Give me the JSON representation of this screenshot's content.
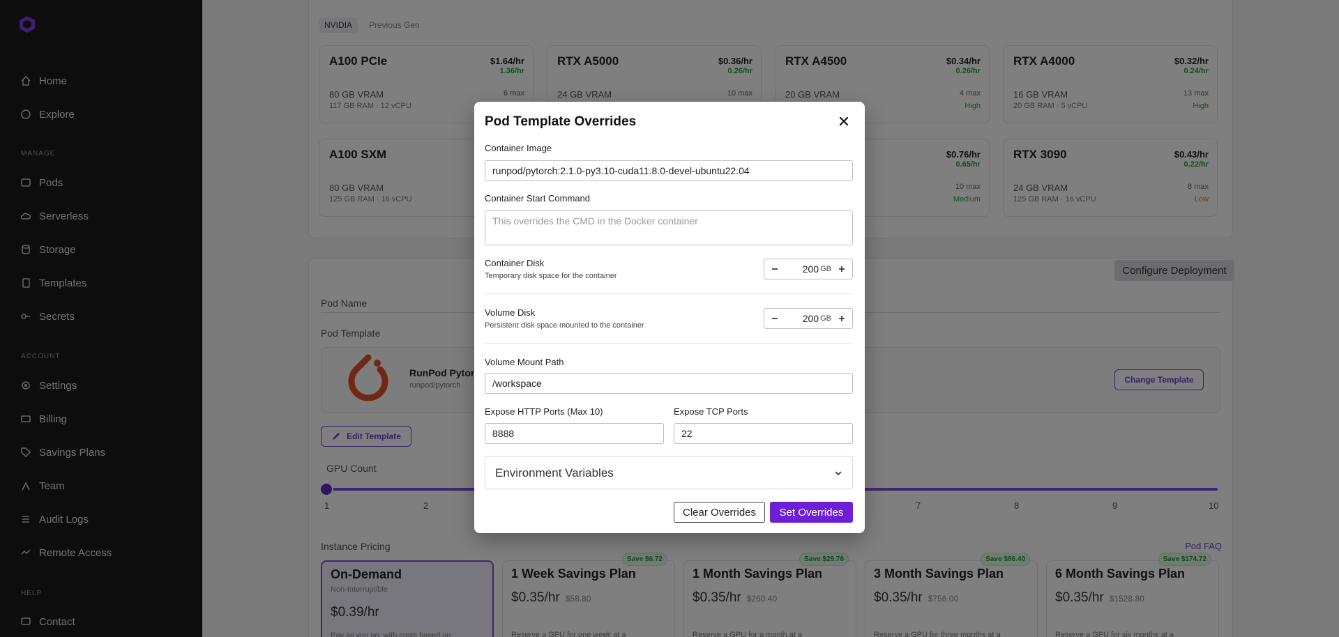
{
  "sidebar": {
    "items": [
      {
        "label": "Home",
        "icon": "home-icon"
      },
      {
        "label": "Explore",
        "icon": "compass-icon"
      },
      {
        "label": "Pods",
        "icon": "pods-icon"
      },
      {
        "label": "Serverless",
        "icon": "cloud-icon"
      },
      {
        "label": "Storage",
        "icon": "database-icon"
      },
      {
        "label": "Templates",
        "icon": "document-icon"
      },
      {
        "label": "Secrets",
        "icon": "key-icon"
      },
      {
        "label": "Settings",
        "icon": "gear-icon"
      },
      {
        "label": "Billing",
        "icon": "billing-icon"
      },
      {
        "label": "Savings Plans",
        "icon": "tag-icon"
      },
      {
        "label": "Team",
        "icon": "team-icon"
      },
      {
        "label": "Audit Logs",
        "icon": "list-icon"
      },
      {
        "label": "Remote Access",
        "icon": "remote-icon"
      },
      {
        "label": "Contact",
        "icon": "chat-icon"
      }
    ],
    "sections": {
      "manage": "MANAGE",
      "account": "ACCOUNT",
      "help": "HELP"
    }
  },
  "gpu_tabs": {
    "nvidia": "NVIDIA",
    "previous_gen": "Previous Gen"
  },
  "gpus": [
    {
      "name": "A100 PCIe",
      "price": "$1.64/hr",
      "spot": "1.36/hr",
      "vram": "80 GB VRAM",
      "ram": "117 GB RAM · 12 vCPU",
      "max": "6 max",
      "avail": ""
    },
    {
      "name": "RTX A5000",
      "price": "$0.36/hr",
      "spot": "0.26/hr",
      "vram": "24 GB VRAM",
      "ram": "",
      "max": "10 max",
      "avail": ""
    },
    {
      "name": "RTX A4500",
      "price": "$0.34/hr",
      "spot": "0.26/hr",
      "vram": "20 GB VRAM",
      "ram": "",
      "max": "4 max",
      "avail": "High"
    },
    {
      "name": "RTX A4000",
      "price": "$0.32/hr",
      "spot": "0.24/hr",
      "vram": "16 GB VRAM",
      "ram": "20 GB RAM · 5 vCPU",
      "max": "13 max",
      "avail": "High"
    },
    {
      "name": "A100 SXM",
      "price": "",
      "spot": "",
      "vram": "80 GB VRAM",
      "ram": "125 GB RAM · 16 vCPU",
      "max": "",
      "avail": ""
    },
    {
      "name": "",
      "price": "$0.76/hr",
      "spot": "0.65/hr",
      "vram": "",
      "ram": "",
      "max": "10 max",
      "avail": "Medium"
    },
    {
      "name": "RTX 3090",
      "price": "$0.43/hr",
      "spot": "0.22/hr",
      "vram": "24 GB VRAM",
      "ram": "125 GB RAM · 16 vCPU",
      "max": "8 max",
      "avail": "Low"
    }
  ],
  "deploy": {
    "configure_label": "Configure Deployment",
    "pod_name_label": "Pod Name",
    "pod_template_label": "Pod Template",
    "template_name": "RunPod Pytorch",
    "template_image": "runpod/pytorch",
    "change_template": "Change Template",
    "edit_template": "Edit Template",
    "gpu_count_label": "GPU Count",
    "gpu_count_ticks": [
      "1",
      "2",
      "7",
      "8",
      "9",
      "10"
    ],
    "instance_pricing_label": "Instance Pricing",
    "faq_link": "Pod FAQ"
  },
  "plans": [
    {
      "title": "On-Demand",
      "sub": "Non-Interruptible",
      "price": "$0.39/hr",
      "total": "",
      "desc": "Pay as you go, with costs based on",
      "save": ""
    },
    {
      "title": "1 Week Savings Plan",
      "sub": "",
      "price": "$0.35/hr",
      "total": "$58.80",
      "desc": "Reserve a GPU for one week at a",
      "save": "Save $6.72"
    },
    {
      "title": "1 Month Savings Plan",
      "sub": "",
      "price": "$0.35/hr",
      "total": "$260.40",
      "desc": "Reserve a GPU for a month at a",
      "save": "Save $29.76"
    },
    {
      "title": "3 Month Savings Plan",
      "sub": "",
      "price": "$0.35/hr",
      "total": "$756.00",
      "desc": "Reserve a GPU for three months at a",
      "save": "Save $86.40"
    },
    {
      "title": "6 Month Savings Plan",
      "sub": "",
      "price": "$0.35/hr",
      "total": "$1528.80",
      "desc": "Reserve a GPU for six months at a",
      "save": "Save $174.72"
    }
  ],
  "modal": {
    "title": "Pod Template Overrides",
    "container_image_label": "Container Image",
    "container_image_value": "runpod/pytorch:2.1.0-py3.10-cuda11.8.0-devel-ubuntu22.04",
    "start_command_label": "Container Start Command",
    "start_command_placeholder": "This overrides the CMD in the Docker container",
    "container_disk_label": "Container Disk",
    "container_disk_sub": "Temporary disk space for the container",
    "container_disk_value": "200",
    "volume_disk_label": "Volume Disk",
    "volume_disk_sub": "Persistent disk space mounted to the container",
    "volume_disk_value": "200",
    "disk_unit": "GB",
    "volume_mount_label": "Volume Mount Path",
    "volume_mount_value": "/workspace",
    "http_ports_label": "Expose HTTP Ports (Max 10)",
    "http_ports_value": "8888",
    "tcp_ports_label": "Expose TCP Ports",
    "tcp_ports_value": "22",
    "env_vars_label": "Environment Variables",
    "clear_label": "Clear Overrides",
    "set_label": "Set Overrides"
  },
  "colors": {
    "accent": "#6d1fd8",
    "success": "#22a33a",
    "warning": "#d48806"
  }
}
